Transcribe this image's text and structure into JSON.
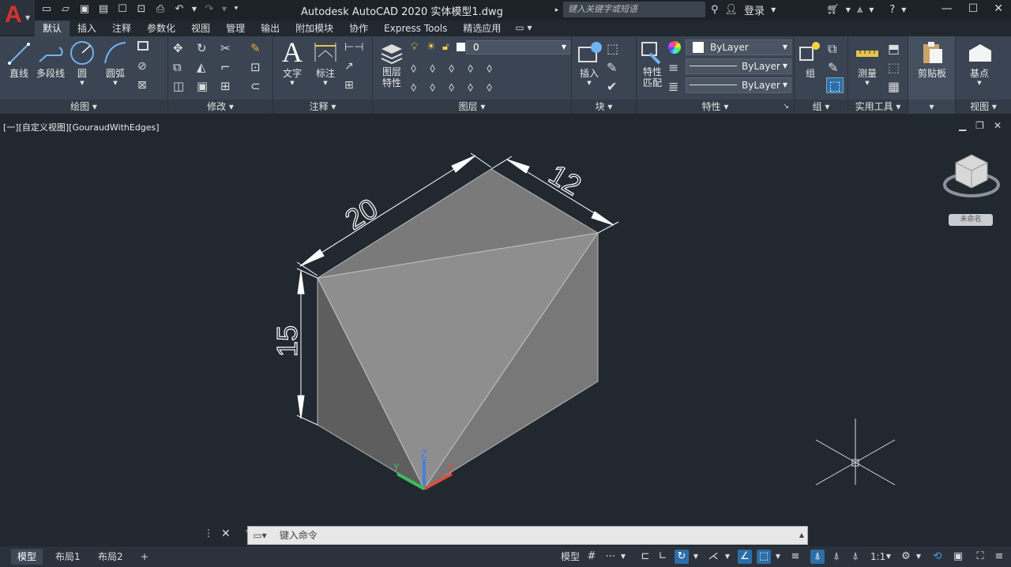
{
  "app": {
    "title": "Autodesk AutoCAD 2020    实体模型1.dwg",
    "search_placeholder": "键入关键字或短语",
    "login": "登录",
    "accent": "#2d6ea8",
    "logo_color": "#d9312b"
  },
  "tabs": [
    "默认",
    "插入",
    "注释",
    "参数化",
    "视图",
    "管理",
    "输出",
    "附加模块",
    "协作",
    "Express Tools",
    "精选应用"
  ],
  "ribbon": {
    "draw": {
      "label": "绘图",
      "tools": [
        "直线",
        "多段线",
        "圆",
        "圆弧"
      ]
    },
    "modify": {
      "label": "修改"
    },
    "annotation": {
      "label": "注释",
      "tools": [
        "文字",
        "标注"
      ]
    },
    "layers": {
      "label": "图层",
      "tool": "图层\n特性",
      "tool_l1": "图层",
      "tool_l2": "特性",
      "current_layer": "0"
    },
    "block": {
      "label": "块",
      "tool": "插入"
    },
    "properties": {
      "label": "特性",
      "tool_l1": "特性",
      "tool_l2": "匹配",
      "color": "ByLayer",
      "linetype": "ByLayer",
      "lineweight": "ByLayer"
    },
    "groups": {
      "label": "组",
      "tool": "组"
    },
    "utilities": {
      "label": "实用工具",
      "tool": "测量"
    },
    "clipboard": {
      "label": "剪贴板",
      "tool": "剪贴板"
    },
    "view": {
      "label": "视图",
      "tool": "基点"
    }
  },
  "viewport": {
    "label": "[一][自定义视图][GouraudWithEdges]",
    "viewcube_label": "未命名",
    "dimensions": {
      "length": "20",
      "width": "12",
      "height": "15"
    }
  },
  "command": {
    "placeholder": "键入命令"
  },
  "status": {
    "layout_tabs": [
      "模型",
      "布局1",
      "布局2"
    ],
    "model_label": "模型",
    "scale": "1:1"
  }
}
